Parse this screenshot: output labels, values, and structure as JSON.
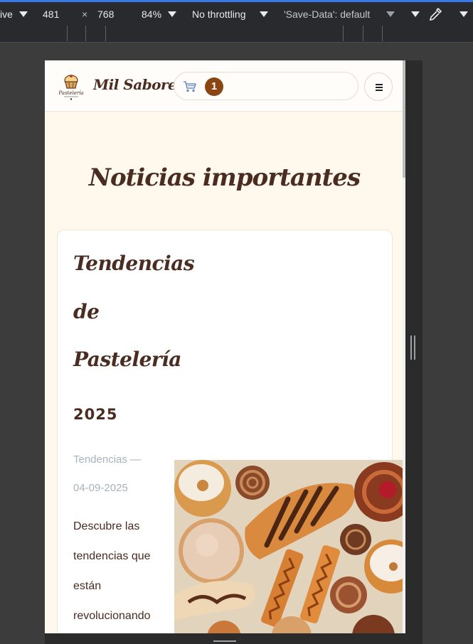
{
  "devtools": {
    "mode_label": "ive",
    "width_value": "481",
    "times_symbol": "×",
    "height_value": "768",
    "zoom_value": "84%",
    "throttling_value": "No throttling",
    "save_data_value": "'Save-Data': default"
  },
  "site": {
    "brand": "Mil Sabores",
    "logo_text": "Pastelería",
    "cart_count": "1",
    "menu_icon": "menu-icon",
    "page_title": "Noticias importantes",
    "accent_color": "#8b4513",
    "text_color": "#4a2c21",
    "article": {
      "title_lines": [
        "Tendencias",
        "de",
        "Pastelería"
      ],
      "year": "2025",
      "category": "Tendencias —",
      "date": "04-09-2025",
      "excerpt_lines": [
        "Descubre las",
        "tendencias que",
        "están",
        "revolucionando"
      ]
    }
  }
}
